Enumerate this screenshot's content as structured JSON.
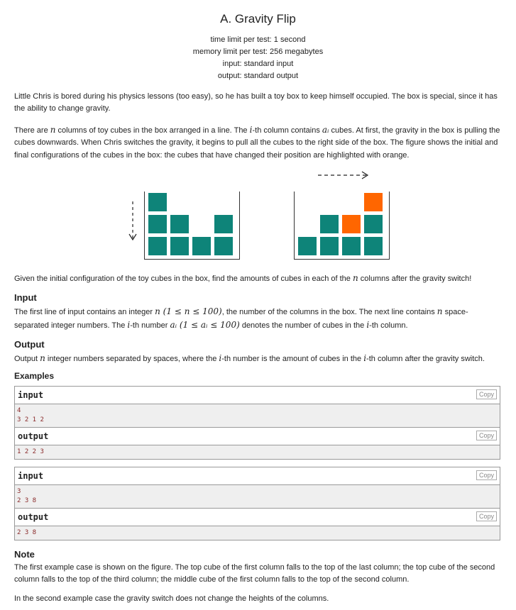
{
  "problem": {
    "title": "A. Gravity Flip",
    "time_limit": "time limit per test: 1 second",
    "memory_limit": "memory limit per test: 256 megabytes",
    "input_file": "input: standard input",
    "output_file": "output: standard output"
  },
  "statement": {
    "p1": "Little Chris is bored during his physics lessons (too easy), so he has built a toy box to keep himself occupied. The box is special, since it has the ability to change gravity.",
    "p2_a": "There are ",
    "p2_n": "n",
    "p2_b": " columns of toy cubes in the box arranged in a line. The ",
    "p2_i": "i",
    "p2_c": "-th column contains ",
    "p2_ai": "aᵢ",
    "p2_d": " cubes. At first, the gravity in the box is pulling the cubes downwards. When Chris switches the gravity, it begins to pull all the cubes to the right side of the box. The figure shows the initial and final configurations of the cubes in the box: the cubes that have changed their position are highlighted with orange.",
    "p3_a": "Given the initial configuration of the toy cubes in the box, find the amounts of cubes in each of the ",
    "p3_n": "n",
    "p3_b": " columns after the gravity switch!"
  },
  "figure": {
    "initial_heights": [
      3,
      2,
      1,
      2
    ],
    "final_heights": [
      1,
      2,
      2,
      3
    ],
    "colors": {
      "cube": "#0e8479",
      "moved": "#ff6600"
    }
  },
  "input_section": {
    "heading": "Input",
    "t1": "The first line of input contains an integer ",
    "n": "n",
    "c1": " (1 ≤ ",
    "n2": "n",
    "c2": " ≤ 100)",
    "t2": ", the number of the columns in the box. The next line contains ",
    "n3": "n",
    "t3": " space-separated integer numbers. The ",
    "i": "i",
    "t4": "-th number ",
    "ai": "aᵢ",
    "c3": " (1 ≤ ",
    "ai2": "aᵢ",
    "c4": " ≤ 100)",
    "t5": " denotes the number of cubes in the ",
    "i2": "i",
    "t6": "-th column."
  },
  "output_section": {
    "heading": "Output",
    "t1": "Output ",
    "n": "n",
    "t2": " integer numbers separated by spaces, where the ",
    "i": "i",
    "t3": "-th number is the amount of cubes in the ",
    "i2": "i",
    "t4": "-th column after the gravity switch."
  },
  "examples": {
    "heading": "Examples",
    "input_label": "input",
    "output_label": "output",
    "copy_label": "Copy",
    "ex1_input": "4\n3 2 1 2",
    "ex1_output": "1 2 2 3",
    "ex2_input": "3\n2 3 8",
    "ex2_output": "2 3 8"
  },
  "note": {
    "heading": "Note",
    "p1": "The first example case is shown on the figure. The top cube of the first column falls to the top of the last column; the top cube of the second column falls to the top of the third column; the middle cube of the first column falls to the top of the second column.",
    "p2": "In the second example case the gravity switch does not change the heights of the columns."
  }
}
